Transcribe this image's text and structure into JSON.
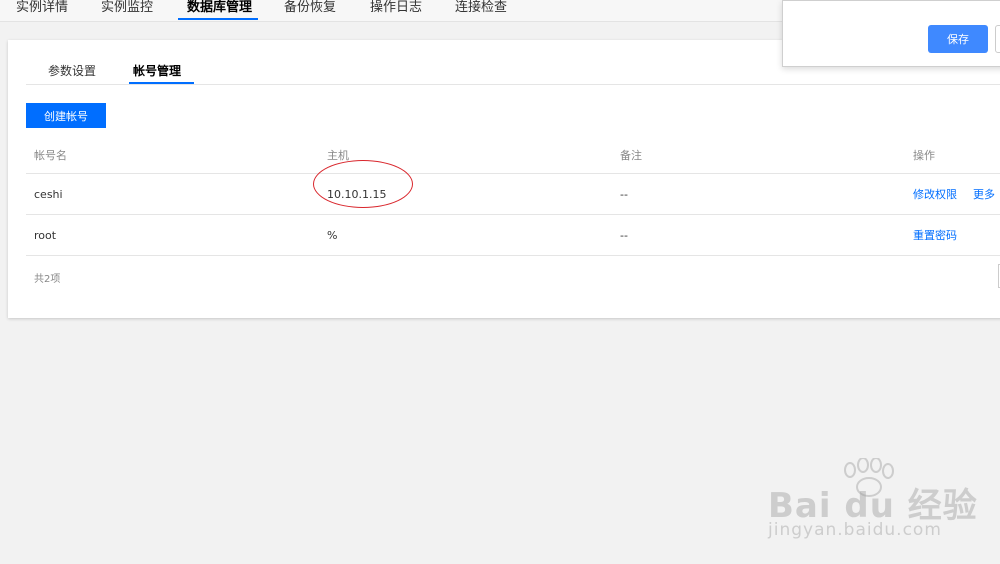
{
  "top_nav": {
    "tabs": [
      {
        "label": "实例详情"
      },
      {
        "label": "实例监控"
      },
      {
        "label": "数据库管理"
      },
      {
        "label": "备份恢复"
      },
      {
        "label": "操作日志"
      },
      {
        "label": "连接检查"
      }
    ],
    "active_index": 2
  },
  "popup": {
    "save_label": "保存"
  },
  "sub_tabs": {
    "tabs": [
      {
        "label": "参数设置"
      },
      {
        "label": "帐号管理"
      }
    ],
    "active_index": 1
  },
  "create_button": {
    "label": "创建帐号"
  },
  "table": {
    "columns": [
      "帐号名",
      "主机",
      "备注",
      "操作"
    ],
    "rows": [
      {
        "account": "ceshi",
        "host": "10.10.1.15",
        "remark": "--",
        "actions": [
          "修改权限",
          "更多"
        ]
      },
      {
        "account": "root",
        "host": "%",
        "remark": "--",
        "actions": [
          "重置密码"
        ]
      }
    ],
    "total": "共2项"
  },
  "watermark": {
    "main": "Bai du 经验",
    "sub": "jingyan.baidu.com"
  },
  "colors": {
    "primary": "#006eff",
    "annotation": "#d9262c"
  }
}
